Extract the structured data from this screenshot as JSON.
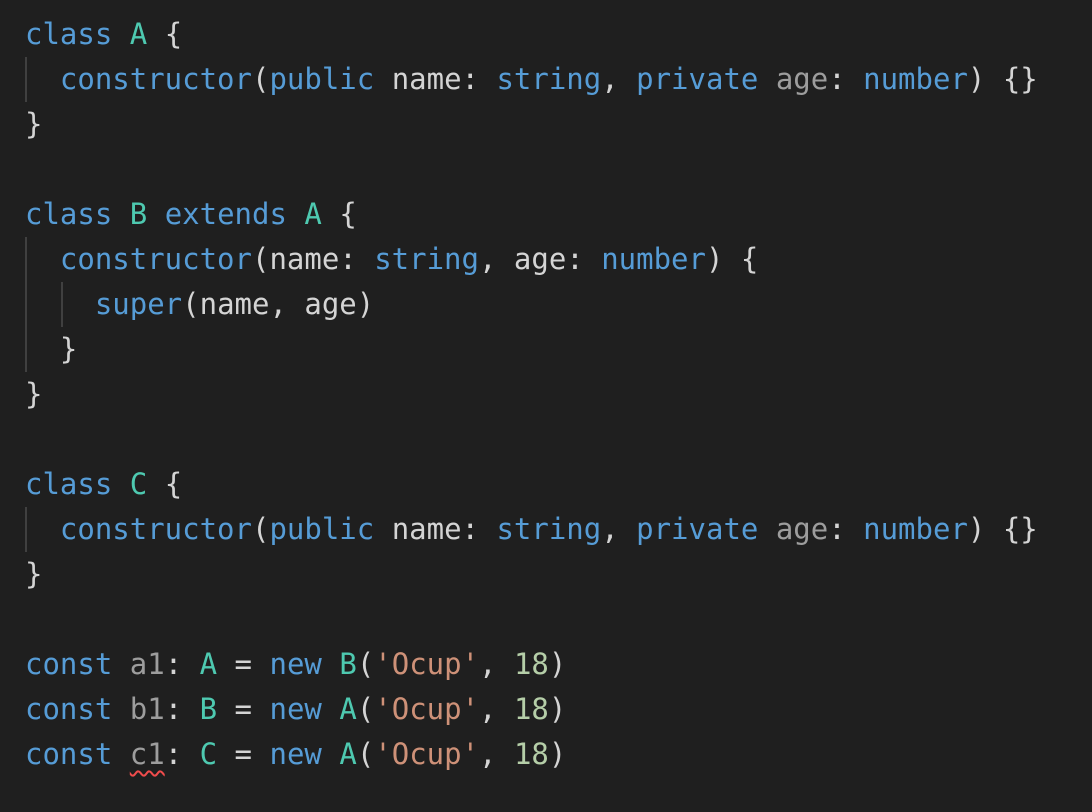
{
  "code": {
    "l1": {
      "k": "class",
      "sp1": " ",
      "name": "A",
      "sp2": " ",
      "brace": "{"
    },
    "l2": {
      "indent": "  ",
      "ctor": "constructor",
      "paren": "(",
      "pub": "public",
      "sp": " ",
      "p1": "name",
      "col1": ": ",
      "t1": "string",
      "comma": ", ",
      "priv": "private",
      "sp2": " ",
      "p2": "age",
      "col2": ": ",
      "t2": "number",
      "tail": ") {}"
    },
    "l3": {
      "brace": "}"
    },
    "l5": {
      "k": "class",
      "sp1": " ",
      "name": "B",
      "sp2": " ",
      "ext": "extends",
      "sp3": " ",
      "base": "A",
      "sp4": " ",
      "brace": "{"
    },
    "l6": {
      "indent": "  ",
      "ctor": "constructor",
      "paren": "(",
      "p1": "name",
      "col1": ": ",
      "t1": "string",
      "comma": ", ",
      "p2": "age",
      "col2": ": ",
      "t2": "number",
      "tail": ") {"
    },
    "l7": {
      "indent": "    ",
      "sup": "super",
      "args": "(name, age)"
    },
    "l8": {
      "indent": "  ",
      "brace": "}"
    },
    "l9": {
      "brace": "}"
    },
    "l11": {
      "k": "class",
      "sp1": " ",
      "name": "C",
      "sp2": " ",
      "brace": "{"
    },
    "l12": {
      "indent": "  ",
      "ctor": "constructor",
      "paren": "(",
      "pub": "public",
      "sp": " ",
      "p1": "name",
      "col1": ": ",
      "t1": "string",
      "comma": ", ",
      "priv": "private",
      "sp2": " ",
      "p2": "age",
      "col2": ": ",
      "t2": "number",
      "tail": ") {}"
    },
    "l13": {
      "brace": "}"
    },
    "l15": {
      "k": "const",
      "sp1": " ",
      "v": "a1",
      "col": ": ",
      "t": "A",
      "eq": " = ",
      "nw": "new",
      "sp2": " ",
      "cls": "B",
      "op": "(",
      "s": "'Ocup'",
      "comma": ", ",
      "n": "18",
      "cp": ")"
    },
    "l16": {
      "k": "const",
      "sp1": " ",
      "v": "b1",
      "col": ": ",
      "t": "B",
      "eq": " = ",
      "nw": "new",
      "sp2": " ",
      "cls": "A",
      "op": "(",
      "s": "'Ocup'",
      "comma": ", ",
      "n": "18",
      "cp": ")"
    },
    "l17": {
      "k": "const",
      "sp1": " ",
      "v": "c1",
      "col": ": ",
      "t": "C",
      "eq": " = ",
      "nw": "new",
      "sp2": " ",
      "cls": "A",
      "op": "(",
      "s": "'Ocup'",
      "comma": ", ",
      "n": "18",
      "cp": ")"
    }
  },
  "colors": {
    "background": "#1f1f1f",
    "keyword": "#569cd6",
    "type": "#4ec9b0",
    "string": "#ce9178",
    "number": "#b5cea8",
    "error_squiggle": "#f14c4c"
  }
}
